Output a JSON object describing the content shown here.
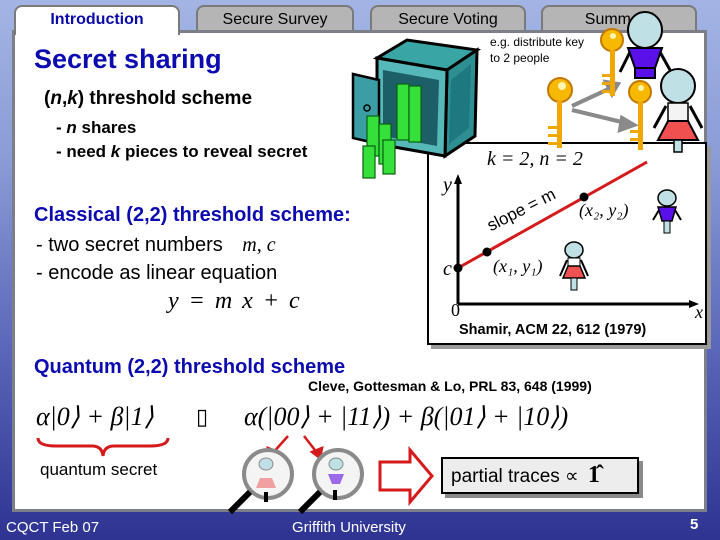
{
  "tabs": [
    {
      "label": "Introduction",
      "active": true
    },
    {
      "label": "Secure Survey",
      "active": false
    },
    {
      "label": "Secure Voting",
      "active": false
    },
    {
      "label": "Summary",
      "active": false
    }
  ],
  "slide": {
    "title": "Secret sharing",
    "threshold_heading_prefix": "(",
    "threshold_heading_n": "n",
    "threshold_heading_comma": ",",
    "threshold_heading_k": "k",
    "threshold_heading_suffix": ") threshold scheme",
    "bullet1_dash": "- ",
    "bullet1_var": "n",
    "bullet1_text": " shares",
    "bullet2_prefix": "- need ",
    "bullet2_var": "k",
    "bullet2_text": " pieces to reveal secret",
    "illustration_caption_line1": "e.g. distribute key",
    "illustration_caption_line2": "to 2 people",
    "classical_heading": "Classical (2,2) threshold scheme:",
    "classical_bullet1": "- two secret numbers",
    "classical_bullet1_vars": "m, c",
    "classical_bullet2": "- encode as linear equation",
    "equation": "y = m x + c",
    "quantum_heading": "Quantum (2,2) threshold scheme",
    "quantum_reference": "Cleve, Gottesman & Lo, PRL 83, 648 (1999)",
    "quantum_secret_state": "α|0⟩ + β|1⟩",
    "mapping_symbol": "▯",
    "encoded_state": "α(|00⟩ + |11⟩) + β(|01⟩ + |10⟩)",
    "quantum_secret_label": "quantum secret",
    "partial_traces_label": "partial traces ∝",
    "identity_symbol": "1̂"
  },
  "graph": {
    "label": "k = 2, n = 2",
    "y_axis": "y",
    "x_axis": "x",
    "origin": "0",
    "intercept": "c",
    "slope_label": "slope = m",
    "point1": "(x₁, y₁)",
    "point2": "(x₂, y₂)",
    "reference": "Shamir, ACM 22, 612 (1979)"
  },
  "footer": {
    "left": "CQCT Feb 07",
    "center": "Griffith University",
    "page": "5"
  },
  "colors": {
    "heading_blue": "#0b0bb0",
    "line_red": "#d41a1a",
    "key_gold": "#f0a800",
    "person_purple": "#5a10e8",
    "person_pink": "#f05050",
    "person_head": "#bfe0e4"
  }
}
